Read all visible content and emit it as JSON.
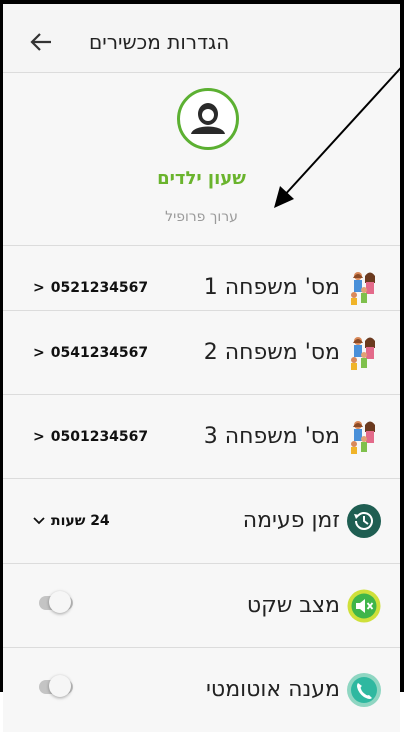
{
  "header": {
    "title": "הגדרות מכשירים",
    "back_icon": "arrow-left-icon"
  },
  "profile": {
    "name": "שעון ילדים",
    "edit_label": "ערוך פרופיל",
    "colors": {
      "accent": "#6ab42d"
    }
  },
  "family": [
    {
      "label": "מס' משפחה 1",
      "number": "0521234567",
      "chevron": ">",
      "icon": "family-icon"
    },
    {
      "label": "מס' משפחה 2",
      "number": "0541234567",
      "chevron": ">",
      "icon": "family-icon"
    },
    {
      "label": "מס' משפחה 3",
      "number": "0501234567",
      "chevron": ">",
      "icon": "family-icon"
    }
  ],
  "wake_time": {
    "label": "זמן פעימה",
    "value": "24 שעות",
    "icon": "history-clock-icon"
  },
  "silent_mode": {
    "label": "מצב שקט",
    "enabled": false,
    "icon": "mute-speaker-icon"
  },
  "auto_answer": {
    "label": "מענה אוטומטי",
    "enabled": false,
    "icon": "phone-icon"
  }
}
